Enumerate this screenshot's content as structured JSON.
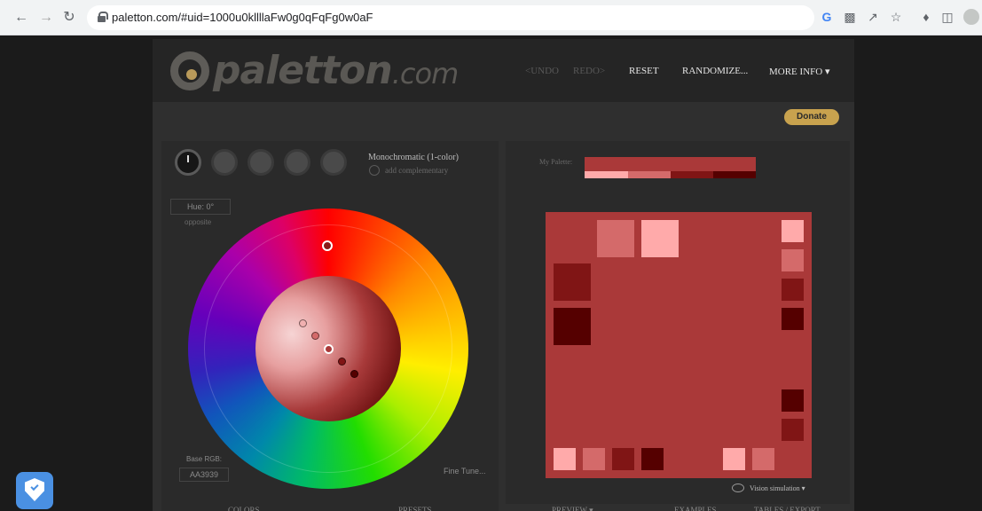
{
  "browser": {
    "url": "paletton.com/#uid=1000u0kllllaFw0g0qFqFg0w0aF"
  },
  "header": {
    "logo_text": "paletton",
    "logo_suffix": ".com",
    "menu": {
      "undo": "<UNDO",
      "redo": "REDO>",
      "reset": "RESET",
      "randomize": "RANDOMIZE...",
      "more_info": "MORE INFO ▾"
    }
  },
  "donate_label": "Donate",
  "left": {
    "scheme_name": "Monochromatic (1-color)",
    "add_complementary": "add complementary",
    "hue": "Hue: 0°",
    "opposite": "opposite",
    "base_rgb_label": "Base RGB:",
    "base_rgb_value": "AA3939",
    "fine_tune": "Fine Tune...",
    "tabs": {
      "colors": "COLORS",
      "presets": "PRESETS"
    }
  },
  "right": {
    "my_palette": "My Palette:",
    "vision_simulation": "Vision simulation ▾",
    "tabs": {
      "preview": "PREVIEW ▾",
      "examples": "EXAMPLES",
      "tables": "TABLES / EXPORT"
    }
  },
  "colors": {
    "base": "#AA3939",
    "light1": "#FFAAAA",
    "light2": "#D46A6A",
    "dark1": "#801515",
    "dark2": "#550000"
  }
}
